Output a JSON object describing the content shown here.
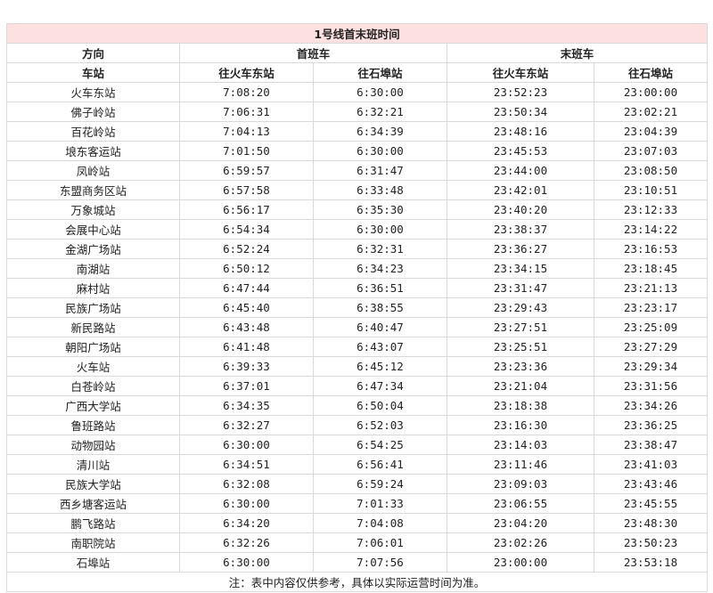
{
  "title": "1号线首末班时间",
  "headers": {
    "direction": "方向",
    "first_train": "首班车",
    "last_train": "末班车",
    "station": "车站",
    "dir_a": "往火车东站",
    "dir_b": "往石埠站"
  },
  "rows": [
    {
      "station": "火车东站",
      "first_a": "7:08:20",
      "first_b": "6:30:00",
      "last_a": "23:52:23",
      "last_b": "23:00:00"
    },
    {
      "station": "佛子岭站",
      "first_a": "7:06:31",
      "first_b": "6:32:21",
      "last_a": "23:50:34",
      "last_b": "23:02:21"
    },
    {
      "station": "百花岭站",
      "first_a": "7:04:13",
      "first_b": "6:34:39",
      "last_a": "23:48:16",
      "last_b": "23:04:39"
    },
    {
      "station": "埌东客运站",
      "first_a": "7:01:50",
      "first_b": "6:30:00",
      "last_a": "23:45:53",
      "last_b": "23:07:03"
    },
    {
      "station": "凤岭站",
      "first_a": "6:59:57",
      "first_b": "6:31:47",
      "last_a": "23:44:00",
      "last_b": "23:08:50"
    },
    {
      "station": "东盟商务区站",
      "first_a": "6:57:58",
      "first_b": "6:33:48",
      "last_a": "23:42:01",
      "last_b": "23:10:51"
    },
    {
      "station": "万象城站",
      "first_a": "6:56:17",
      "first_b": "6:35:30",
      "last_a": "23:40:20",
      "last_b": "23:12:33"
    },
    {
      "station": "会展中心站",
      "first_a": "6:54:34",
      "first_b": "6:30:00",
      "last_a": "23:38:37",
      "last_b": "23:14:22"
    },
    {
      "station": "金湖广场站",
      "first_a": "6:52:24",
      "first_b": "6:32:31",
      "last_a": "23:36:27",
      "last_b": "23:16:53"
    },
    {
      "station": "南湖站",
      "first_a": "6:50:12",
      "first_b": "6:34:23",
      "last_a": "23:34:15",
      "last_b": "23:18:45"
    },
    {
      "station": "麻村站",
      "first_a": "6:47:44",
      "first_b": "6:36:51",
      "last_a": "23:31:47",
      "last_b": "23:21:13"
    },
    {
      "station": "民族广场站",
      "first_a": "6:45:40",
      "first_b": "6:38:55",
      "last_a": "23:29:43",
      "last_b": "23:23:17"
    },
    {
      "station": "新民路站",
      "first_a": "6:43:48",
      "first_b": "6:40:47",
      "last_a": "23:27:51",
      "last_b": "23:25:09"
    },
    {
      "station": "朝阳广场站",
      "first_a": "6:41:48",
      "first_b": "6:43:07",
      "last_a": "23:25:51",
      "last_b": "23:27:29"
    },
    {
      "station": "火车站",
      "first_a": "6:39:33",
      "first_b": "6:45:12",
      "last_a": "23:23:36",
      "last_b": "23:29:34"
    },
    {
      "station": "白苍岭站",
      "first_a": "6:37:01",
      "first_b": "6:47:34",
      "last_a": "23:21:04",
      "last_b": "23:31:56"
    },
    {
      "station": "广西大学站",
      "first_a": "6:34:35",
      "first_b": "6:50:04",
      "last_a": "23:18:38",
      "last_b": "23:34:26"
    },
    {
      "station": "鲁班路站",
      "first_a": "6:32:27",
      "first_b": "6:52:03",
      "last_a": "23:16:30",
      "last_b": "23:36:25"
    },
    {
      "station": "动物园站",
      "first_a": "6:30:00",
      "first_b": "6:54:25",
      "last_a": "23:14:03",
      "last_b": "23:38:47"
    },
    {
      "station": "清川站",
      "first_a": "6:34:51",
      "first_b": "6:56:41",
      "last_a": "23:11:46",
      "last_b": "23:41:03"
    },
    {
      "station": "民族大学站",
      "first_a": "6:32:08",
      "first_b": "6:59:24",
      "last_a": "23:09:03",
      "last_b": "23:43:46"
    },
    {
      "station": "西乡塘客运站",
      "first_a": "6:30:00",
      "first_b": "7:01:33",
      "last_a": "23:06:55",
      "last_b": "23:45:55"
    },
    {
      "station": "鹏飞路站",
      "first_a": "6:34:20",
      "first_b": "7:04:08",
      "last_a": "23:04:20",
      "last_b": "23:48:30"
    },
    {
      "station": "南职院站",
      "first_a": "6:32:26",
      "first_b": "7:06:01",
      "last_a": "23:02:26",
      "last_b": "23:50:23"
    },
    {
      "station": "石埠站",
      "first_a": "6:30:00",
      "first_b": "7:07:56",
      "last_a": "23:00:00",
      "last_b": "23:53:18"
    }
  ],
  "note": "注：表中内容仅供参考，具体以实际运营时间为准。"
}
